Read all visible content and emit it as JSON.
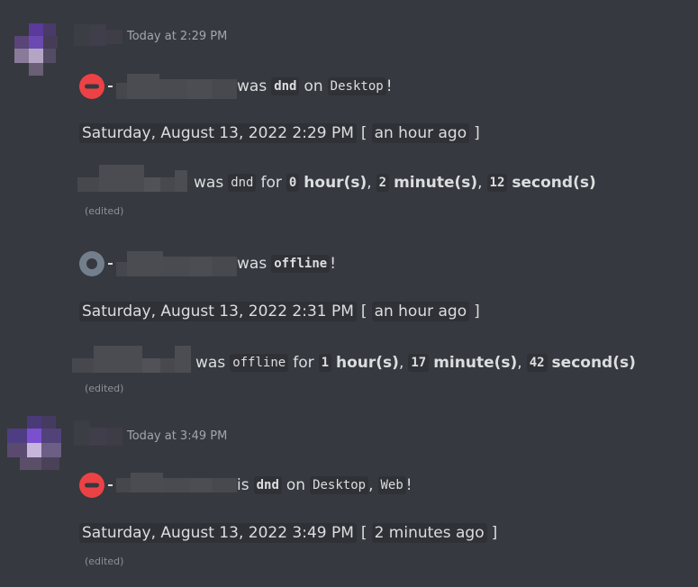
{
  "messages": [
    {
      "timestamp": "Today at 2:29 PM",
      "status_line": {
        "verb": "was",
        "status": "dnd",
        "on": "on",
        "platforms": [
          "Desktop"
        ],
        "end": "!"
      },
      "date_line": {
        "date": "Saturday, August 13, 2022 2:29 PM",
        "open": "[",
        "relative": "an hour ago",
        "close": "]"
      },
      "duration_line": {
        "verb": "was",
        "status": "dnd",
        "for": "for",
        "hours": "0",
        "hours_unit": "hour(s)",
        "minutes": "2",
        "minutes_unit": "minute(s)",
        "seconds": "12",
        "seconds_unit": "second(s)"
      },
      "edited": "(edited)"
    },
    {
      "status_line": {
        "verb": "was",
        "status": "offline",
        "end": "!"
      },
      "date_line": {
        "date": "Saturday, August 13, 2022 2:31 PM",
        "open": "[",
        "relative": "an hour ago",
        "close": "]"
      },
      "duration_line": {
        "verb": "was",
        "status": "offline",
        "for": "for",
        "hours": "1",
        "hours_unit": "hour(s)",
        "minutes": "17",
        "minutes_unit": "minute(s)",
        "seconds": "42",
        "seconds_unit": "second(s)"
      },
      "edited": "(edited)"
    },
    {
      "timestamp": "Today at 3:49 PM",
      "status_line": {
        "verb": "is",
        "status": "dnd",
        "on": "on",
        "platforms": [
          "Desktop",
          "Web"
        ],
        "end": "!"
      },
      "date_line": {
        "date": "Saturday, August 13, 2022 3:49 PM",
        "open": "[",
        "relative": "2 minutes ago",
        "close": "]"
      },
      "edited": "(edited)"
    }
  ],
  "colors": {
    "background": "#36393f",
    "dnd": "#ed4245",
    "offline": "#747f8d",
    "inline_bg": "#2f3136"
  },
  "icons": [
    "dnd-status-icon",
    "offline-status-icon"
  ]
}
